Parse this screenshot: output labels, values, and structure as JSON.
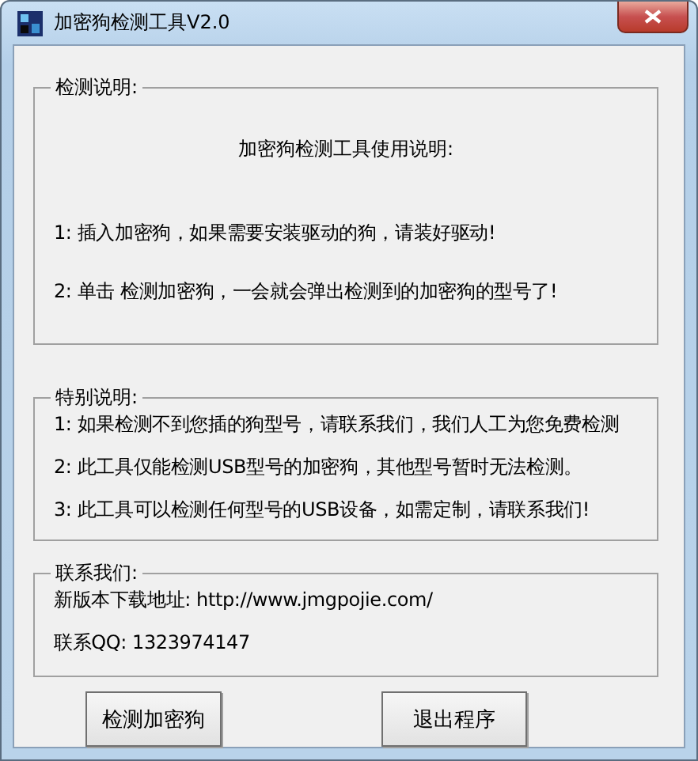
{
  "window": {
    "title": "加密狗检测工具V2.0"
  },
  "groups": [
    {
      "title": "检测说明:",
      "heading": "加密狗检测工具使用说明:",
      "lines": [
        "1: 插入加密狗，如果需要安装驱动的狗，请装好驱动!",
        "2: 单击 检测加密狗，一会就会弹出检测到的加密狗的型号了!"
      ]
    },
    {
      "title": "特别说明:",
      "lines": [
        "1: 如果检测不到您插的狗型号，请联系我们，我们人工为您免费检测",
        "2: 此工具仅能检测USB型号的加密狗，其他型号暂时无法检测。",
        "3: 此工具可以检测任何型号的USB设备，如需定制，请联系我们!"
      ]
    },
    {
      "title": "联系我们:",
      "lines": [
        "新版本下载地址: http://www.jmgpojie.com/",
        "联系QQ: 1323974147"
      ]
    }
  ],
  "buttons": [
    "检测加密狗",
    "退出程序"
  ]
}
